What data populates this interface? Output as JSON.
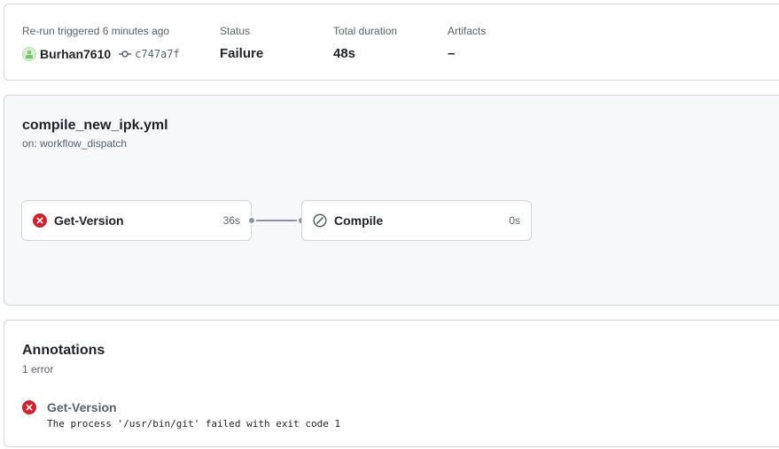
{
  "summary": {
    "trigger_label": "Re-run triggered 6 minutes ago",
    "actor": "Burhan7610",
    "commit_sha": "c747a7f",
    "status_label": "Status",
    "status_value": "Failure",
    "duration_label": "Total duration",
    "duration_value": "48s",
    "artifacts_label": "Artifacts",
    "artifacts_value": "–"
  },
  "workflow": {
    "file": "compile_new_ipk.yml",
    "trigger": "on: workflow_dispatch",
    "jobs": [
      {
        "name": "Get-Version",
        "duration": "36s",
        "status": "failure",
        "icon": "x-circle-icon"
      },
      {
        "name": "Compile",
        "duration": "0s",
        "status": "skipped",
        "icon": "skip-icon"
      }
    ]
  },
  "annotations": {
    "title": "Annotations",
    "count": "1 error",
    "items": [
      {
        "job": "Get-Version",
        "message": "The process '/usr/bin/git' failed with exit code 1",
        "icon": "x-circle-icon"
      }
    ]
  },
  "colors": {
    "failure": "#cf222e",
    "muted": "#59636e",
    "border": "#d0d7de"
  }
}
